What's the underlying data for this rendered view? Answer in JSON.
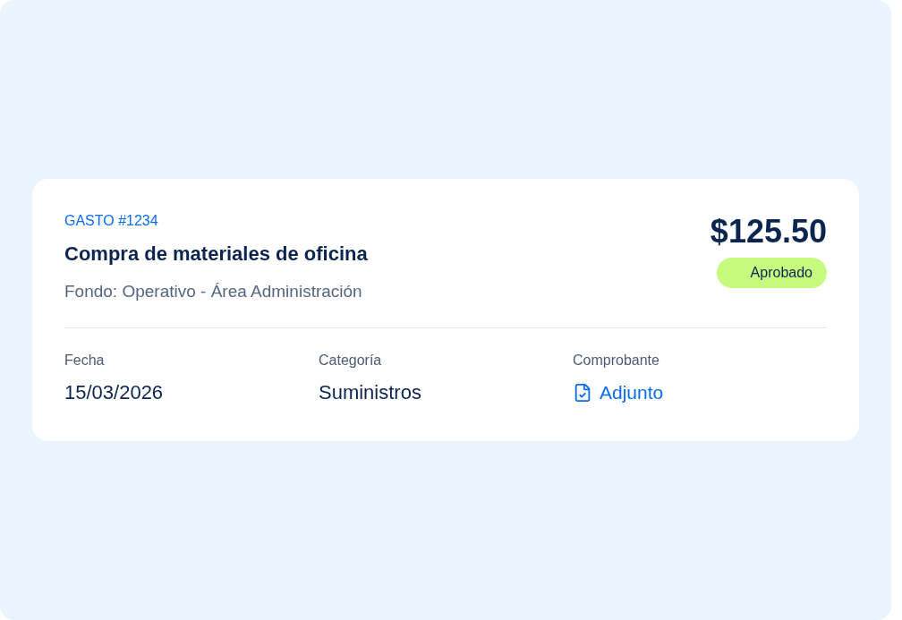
{
  "expense": {
    "code": "GASTO #1234",
    "title": "Compra de materiales de oficina",
    "fund": "Fondo: Operativo - Área Administración",
    "amount": "$125.50",
    "status": {
      "label": "Aprobado",
      "kind": "approved"
    }
  },
  "details": [
    {
      "label": "Fecha",
      "value": "15/03/2026",
      "kind": "text"
    },
    {
      "label": "Categoría",
      "value": "Suministros",
      "kind": "text"
    },
    {
      "label": "Comprobante",
      "value": "Adjunto",
      "kind": "attachment"
    }
  ]
}
